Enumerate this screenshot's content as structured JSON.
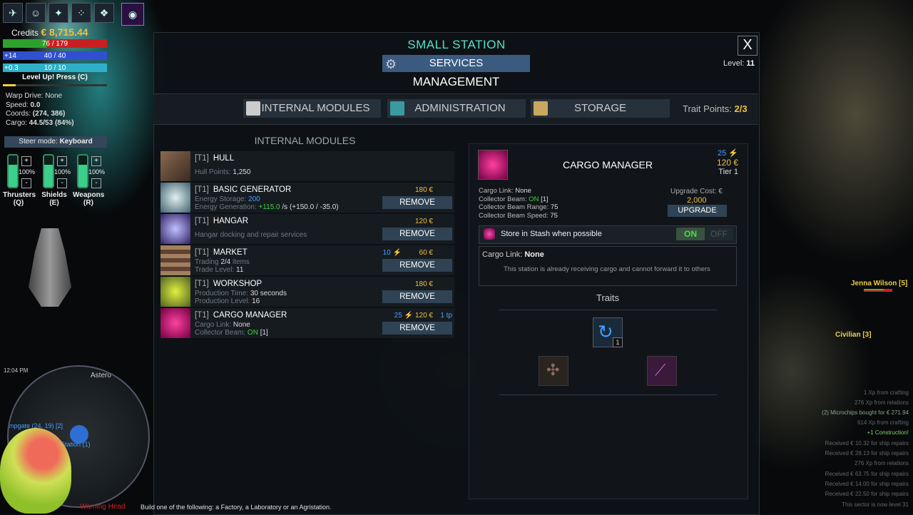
{
  "hud": {
    "credits_label": "Credits",
    "credits_value": "€ 8,715.44",
    "hull_bar": "76 / 179",
    "shield_pre": "+14",
    "shield_bar": "40 / 40",
    "energy_pre": "+0.3",
    "energy_bar": "10 / 10",
    "levelup": "Level Up! Press (C)",
    "warp": "Warp Drive: None",
    "speed_label": "Speed:",
    "speed": "0.0",
    "coords_label": "Coords:",
    "coords": "(274, 386)",
    "cargo_label": "Cargo:",
    "cargo": "44.5/53 (84%)",
    "steer_label": "Steer mode:",
    "steer_value": "Keyboard",
    "systems": [
      {
        "pct": "100%",
        "name": "Thrusters",
        "key": "(Q)"
      },
      {
        "pct": "100%",
        "name": "Shields",
        "key": "(E)"
      },
      {
        "pct": "100%",
        "name": "Weapons",
        "key": "(R)"
      }
    ],
    "clock": "12:04 PM",
    "minimap_labels": [
      "Astero",
      "mpgate (24, 19) [2]",
      "Small Station (1)"
    ]
  },
  "panel": {
    "title": "SMALL STATION",
    "close": "X",
    "level_label": "Level:",
    "level_value": "11",
    "services": "SERVICES",
    "management": "MANAGEMENT",
    "tabs": [
      "INTERNAL MODULES",
      "ADMINISTRATION",
      "STORAGE"
    ],
    "trait_points_label": "Trait Points:",
    "trait_points_value": "2/3",
    "modules_title": "INTERNAL MODULES",
    "remove_label": "REMOVE"
  },
  "modules": [
    {
      "tier": "[T1]",
      "name": "HULL",
      "line1_label": "Hull Points:",
      "line1_value": "1,250",
      "cost": ""
    },
    {
      "tier": "[T1]",
      "name": "BASIC GENERATOR",
      "line1_label": "Energy Storage:",
      "line1_value": "200",
      "line2_label": "Energy Generation:",
      "line2_value": "+115.0",
      "line2_rest": "/s (+150.0 / -35.0)",
      "cost": "180 €"
    },
    {
      "tier": "[T1]",
      "name": "HANGAR",
      "line1_label": "Hangar docking and repair services",
      "cost": "120 €"
    },
    {
      "tier": "[T1]",
      "name": "MARKET",
      "line1_label": "Trading",
      "line1_value": "2/4",
      "line1_rest": "items",
      "line2_label": "Trade Level:",
      "line2_value": "11",
      "cost_energy": "10 ⚡",
      "cost": "60 €"
    },
    {
      "tier": "[T1]",
      "name": "WORKSHOP",
      "line1_label": "Production Time:",
      "line1_value": "30 seconds",
      "line2_label": "Production Level:",
      "line2_value": "16",
      "cost": "180 €"
    },
    {
      "tier": "[T1]",
      "name": "CARGO MANAGER",
      "line1_label": "Cargo Link:",
      "line1_value": "None",
      "line2_label": "Collector Beam:",
      "line2_value": "ON",
      "line2_rest": "[1]",
      "cost_energy": "25 ⚡",
      "cost": "120 €",
      "cost_tp": "1 tp"
    }
  ],
  "detail": {
    "name": "CARGO MANAGER",
    "energy": "25 ⚡",
    "cost": "120 €",
    "tier": "Tier 1",
    "lines": [
      {
        "label": "Cargo Link:",
        "value": "None"
      },
      {
        "label": "Collector Beam:",
        "value": "ON",
        "rest": "[1]"
      },
      {
        "label": "Collector Beam Range:",
        "value": "75"
      },
      {
        "label": "Collector Beam Speed:",
        "value": "75"
      }
    ],
    "upgrade_cost_label": "Upgrade Cost: €",
    "upgrade_cost_value": "2,000",
    "upgrade_button": "UPGRADE",
    "stash_label": "Store in Stash when possible",
    "toggle_on": "ON",
    "toggle_off": "OFF",
    "cargo_link_label": "Cargo Link:",
    "cargo_link_value": "None",
    "cargo_link_desc": "This station is already receiving cargo and cannot forward it to others",
    "traits_title": "Traits",
    "trait_count": "1"
  },
  "world": {
    "jenna": "Jenna Wilson [5]",
    "civilian": "Civilian [3]",
    "log": [
      "1 Xp from crafting",
      "276 Xp from relations",
      "(2) Microchips bought for € 271.94",
      "614 Xp from crafting",
      "+1 Construction!",
      "Received € 10.32 for ship repairs",
      "Received € 28.13 for ship repairs",
      "276 Xp from relations",
      "Received € 63.75 for ship repairs",
      "Received € 14.00 for ship repairs",
      "Received € 22.50 for ship repairs",
      "This sector is now level 31"
    ],
    "warning": "Warning Head",
    "build_text": "Build one of the following: a Factory, a Laboratory or an Agristation."
  }
}
